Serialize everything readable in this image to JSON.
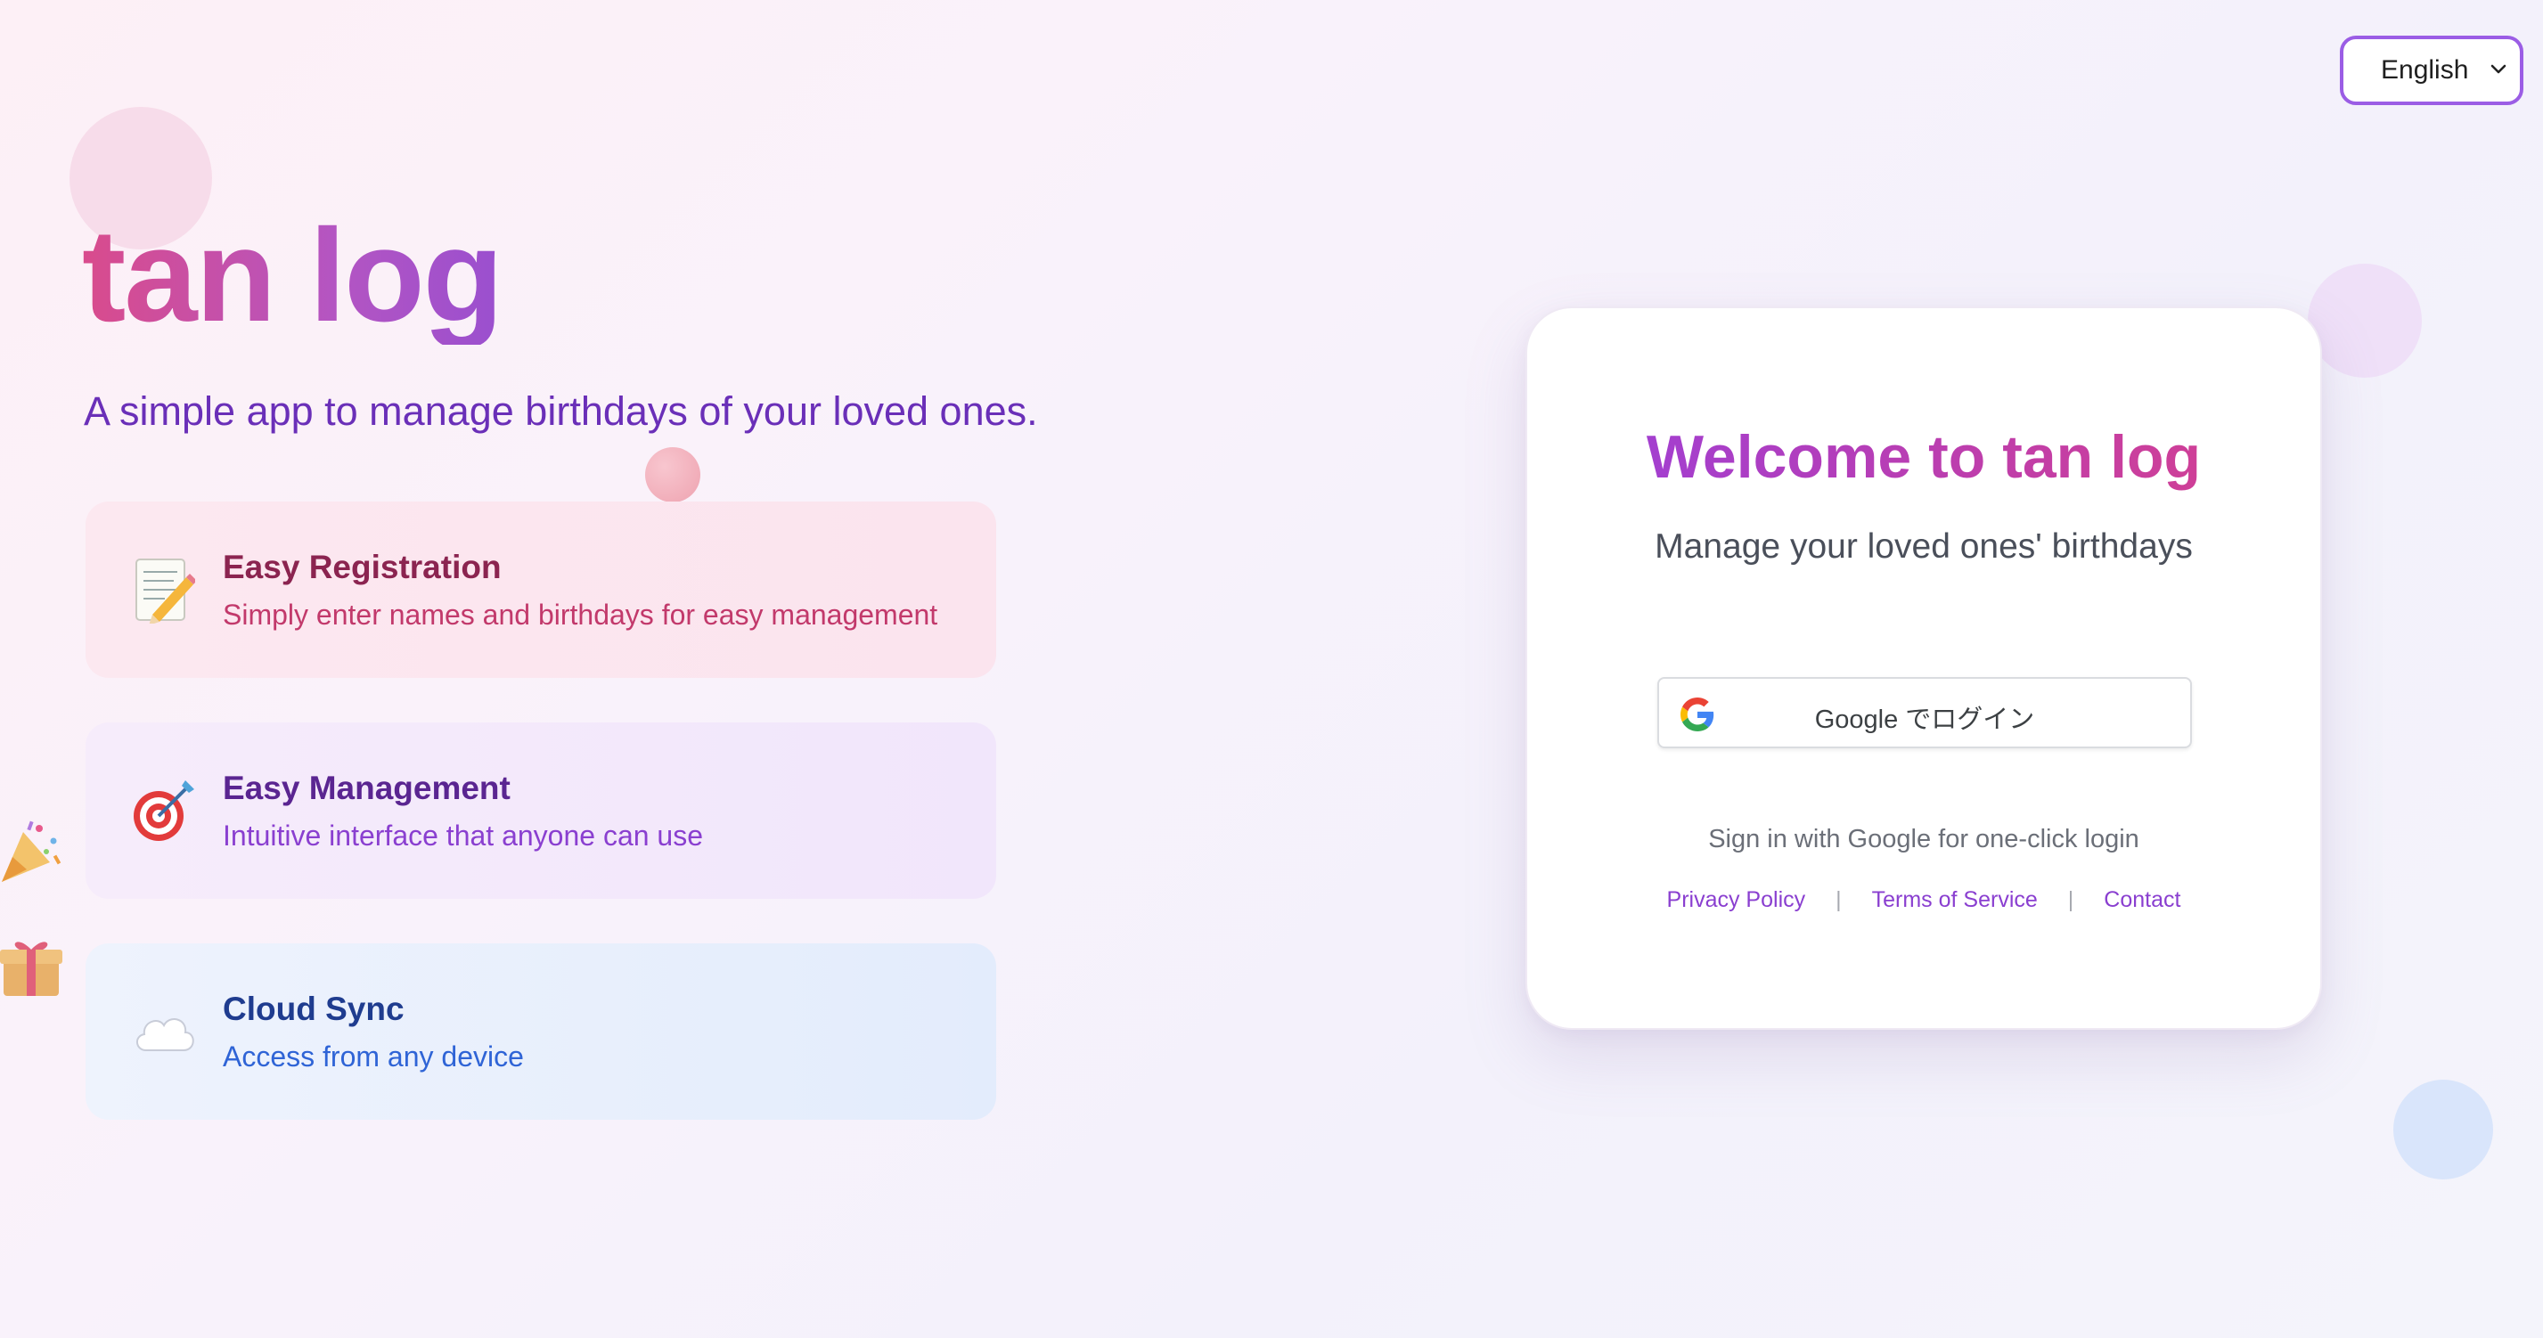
{
  "language_select": {
    "selected": "English",
    "icon": "chevron-down-icon"
  },
  "hero": {
    "title": "tan log",
    "subtitle": "A simple app to manage birthdays of your loved ones."
  },
  "features": [
    {
      "icon": "memo-pencil-icon",
      "title": "Easy Registration",
      "description": "Simply enter names and birthdays for easy management"
    },
    {
      "icon": "target-dart-icon",
      "title": "Easy Management",
      "description": "Intuitive interface that anyone can use"
    },
    {
      "icon": "cloud-icon",
      "title": "Cloud Sync",
      "description": "Access from any device"
    }
  ],
  "decorations": {
    "icons": [
      "party-popper-icon",
      "gift-icon",
      "balloon-icon"
    ]
  },
  "login": {
    "title": "Welcome to tan log",
    "subtitle": "Manage your loved ones' birthdays",
    "google_button_label": "Google でログイン",
    "google_button_icon": "google-g-icon",
    "hint": "Sign in with Google for one-click login",
    "links": {
      "privacy": "Privacy Policy",
      "terms": "Terms of Service",
      "contact": "Contact",
      "separator": "|"
    }
  },
  "colors": {
    "accent_purple": "#9b5de5",
    "title_pink": "#d94b8c",
    "subtitle_purple": "#6a2fb8",
    "link_purple": "#8a3fd0"
  }
}
